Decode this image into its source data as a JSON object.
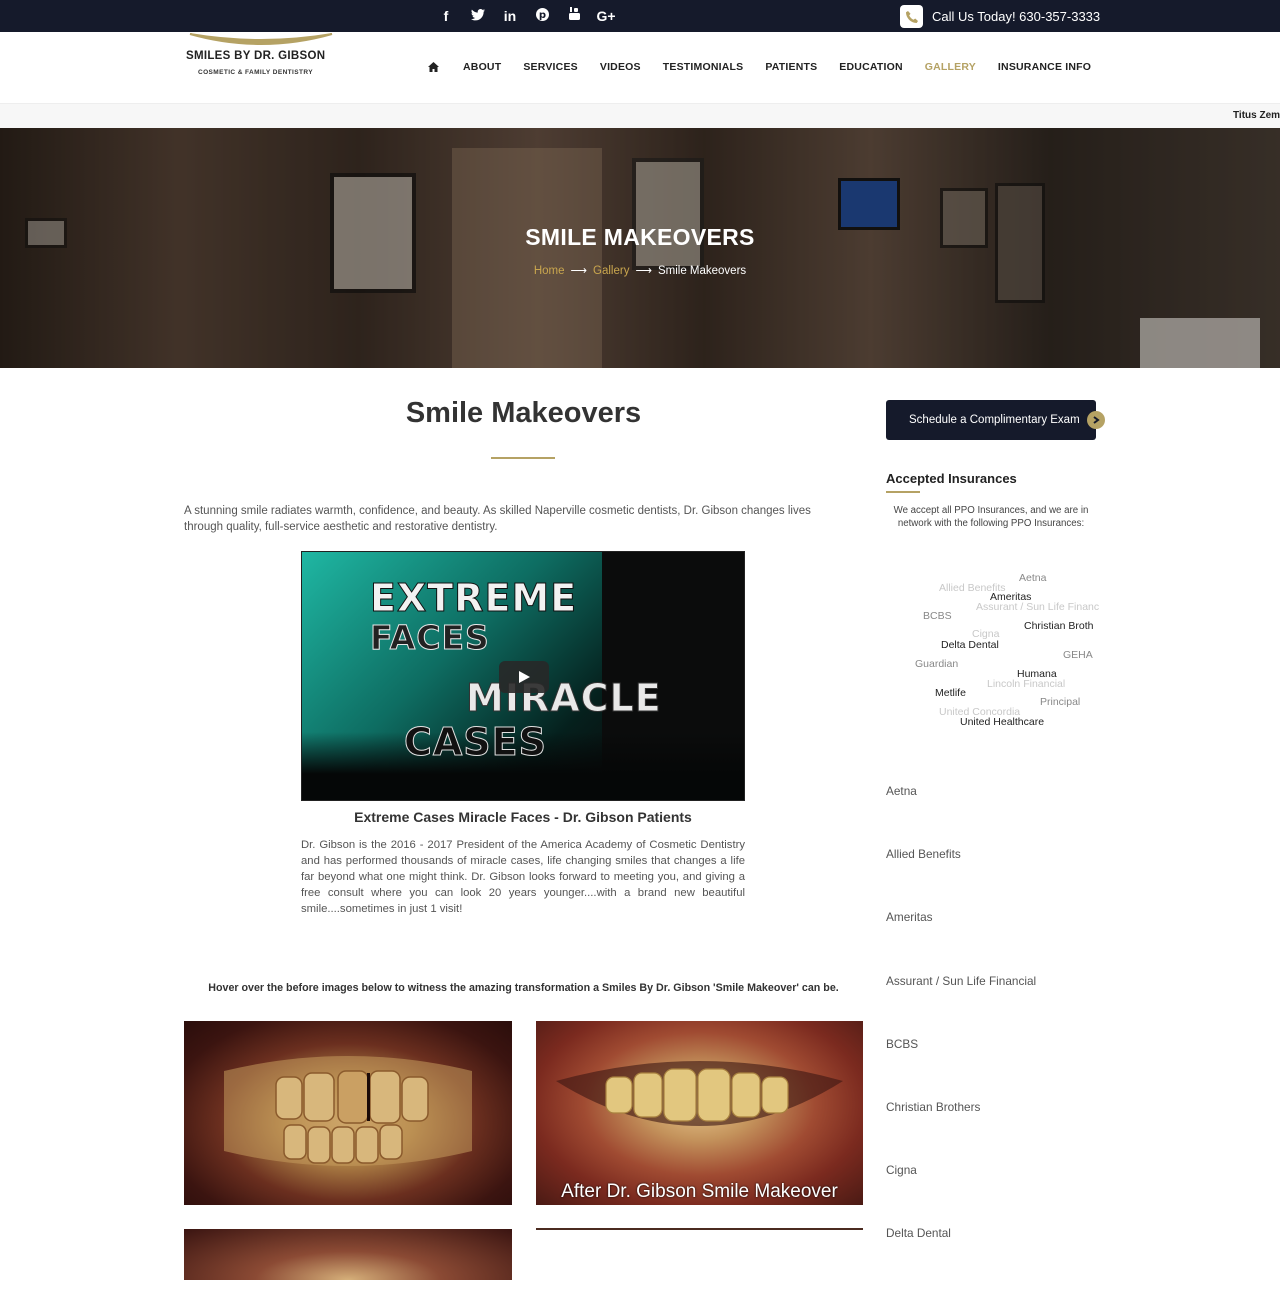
{
  "topbar": {
    "social_icons": [
      "facebook-icon",
      "twitter-icon",
      "linkedin-icon",
      "pinterest-icon",
      "youtube-icon",
      "google-plus-icon"
    ],
    "call_text": "Call Us Today! 630-357-3333"
  },
  "logo": {
    "name": "SMILES BY DR. GIBSON",
    "tagline": "COSMETIC & FAMILY DENTISTRY"
  },
  "nav": {
    "items": [
      {
        "label": "ABOUT",
        "active": false
      },
      {
        "label": "SERVICES",
        "active": false
      },
      {
        "label": "VIDEOS",
        "active": false
      },
      {
        "label": "TESTIMONIALS",
        "active": false
      },
      {
        "label": "PATIENTS",
        "active": false
      },
      {
        "label": "EDUCATION",
        "active": false
      },
      {
        "label": "GALLERY",
        "active": true
      },
      {
        "label": "INSURANCE INFO",
        "active": false
      }
    ]
  },
  "ticker": {
    "text": "Titus Zema"
  },
  "hero": {
    "title": "SMILE MAKEOVERS",
    "breadcrumb": {
      "home": "Home",
      "gallery": "Gallery",
      "current": "Smile Makeovers"
    }
  },
  "main": {
    "title": "Smile Makeovers",
    "intro": "A stunning smile radiates warmth, confidence, and beauty. As skilled Naperville cosmetic dentists, Dr. Gibson changes lives through quality, full-service aesthetic and restorative dentistry.",
    "video": {
      "line1": "EXTREME",
      "line2": "FACES",
      "line3": "MIRACLE",
      "line4": "CASES",
      "title": "Extreme Cases Miracle Faces - Dr. Gibson Patients",
      "description": "Dr. Gibson is the 2016 - 2017 President of the America Academy of Cosmetic Dentistry and has performed thousands of miracle cases, life changing smiles that changes a life far beyond what one might think. Dr. Gibson looks forward to meeting you, and giving a free consult where you can look 20 years younger....with a brand new beautiful smile....sometimes in just 1 visit!"
    },
    "hover_note": "Hover over the before images below to witness the amazing transformation a Smiles By Dr. Gibson 'Smile Makeover' can be.",
    "after_label": "After Dr. Gibson Smile Makeover"
  },
  "sidebar": {
    "schedule_button": "Schedule a Complimentary Exam",
    "accepted_title": "Accepted Insurances",
    "accepted_text": "We accept all PPO Insurances, and we are in network with the following PPO Insurances:",
    "cloud": [
      "Aetna",
      "Allied Benefits",
      "Ameritas",
      "Assurant / Sun Life Financ",
      "BCBS",
      "Christian Broth",
      "Cigna",
      "Delta Dental",
      "GEHA",
      "Guardian",
      "Humana",
      "Lincoln Financial",
      "Metlife",
      "Principal",
      "United Concordia",
      "United Healthcare"
    ],
    "list": [
      "Aetna",
      "Allied Benefits",
      "Ameritas",
      "Assurant / Sun Life Financial",
      "BCBS",
      "Christian Brothers",
      "Cigna",
      "Delta Dental"
    ]
  },
  "colors": {
    "navy": "#151a2b",
    "gold": "#b5a264"
  }
}
